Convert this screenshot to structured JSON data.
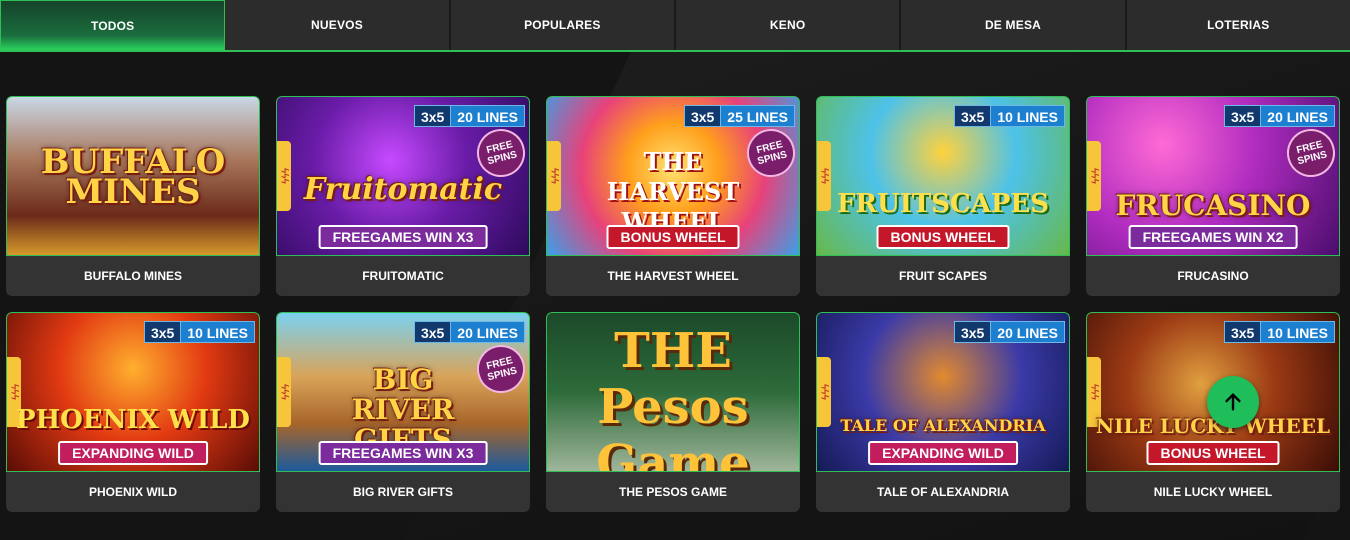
{
  "tabs": [
    {
      "label": "TODOS",
      "active": true
    },
    {
      "label": "NUEVOS",
      "active": false
    },
    {
      "label": "POPULARES",
      "active": false
    },
    {
      "label": "KENO",
      "active": false
    },
    {
      "label": "DE MESA",
      "active": false
    },
    {
      "label": "LOTERIAS",
      "active": false
    }
  ],
  "colors": {
    "accent": "#2fbf55",
    "tab_bg": "#2c2c2c",
    "card_bg": "#333333",
    "page_bg": "#141414"
  },
  "games": [
    {
      "title": "BUFFALO MINES",
      "logo": "BUFFALO MINES"
    },
    {
      "title": "FRUITOMATIC",
      "grid": "3x5",
      "lines": "20 LINES",
      "free": "FREE SPINS",
      "logo": "Fruitomatic",
      "banner": "FREEGAMES WIN X3"
    },
    {
      "title": "THE HARVEST WHEEL",
      "grid": "3x5",
      "lines": "25 LINES",
      "free": "FREE SPINS",
      "logo": "THE HARVEST WHEEL",
      "banner": "BONUS WHEEL"
    },
    {
      "title": "FRUIT SCAPES",
      "grid": "3x5",
      "lines": "10 LINES",
      "logo": "FRUITSCAPES",
      "banner": "BONUS WHEEL"
    },
    {
      "title": "FRUCASINO",
      "grid": "3x5",
      "lines": "20 LINES",
      "free": "FREE SPINS",
      "logo": "FRUCASINO",
      "banner": "FREEGAMES WIN X2"
    },
    {
      "title": "PHOENIX WILD",
      "grid": "3x5",
      "lines": "10 LINES",
      "logo": "PHOENIX WILD",
      "banner": "EXPANDING WILD"
    },
    {
      "title": "BIG RIVER GIFTS",
      "grid": "3x5",
      "lines": "20 LINES",
      "free": "FREE SPINS",
      "logo": "BIG RIVER GIFTS",
      "banner": "FREEGAMES WIN X3"
    },
    {
      "title": "THE PESOS GAME",
      "logo": "THE Pesos Game"
    },
    {
      "title": "TALE OF ALEXANDRIA",
      "grid": "3x5",
      "lines": "20 LINES",
      "logo": "TALE OF ALEXANDRIA",
      "banner": "EXPANDING WILD"
    },
    {
      "title": "NILE LUCKY WHEEL",
      "grid": "3x5",
      "lines": "10 LINES",
      "logo": "NILE LUCKY WHEEL",
      "banner": "BONUS WHEEL"
    }
  ],
  "back_to_top": {
    "icon": "arrow-up-icon"
  }
}
